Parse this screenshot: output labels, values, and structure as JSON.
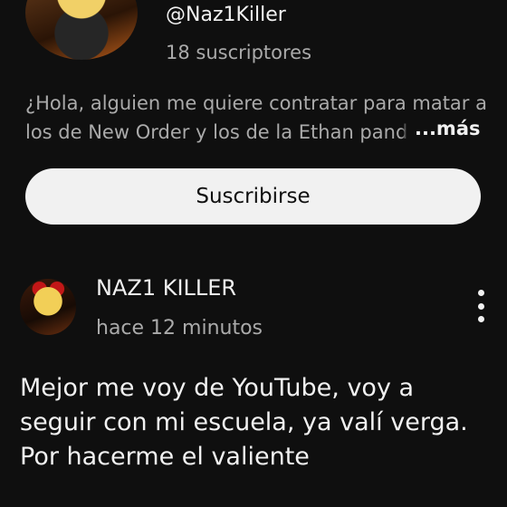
{
  "channel": {
    "handle": "@Naz1Killer",
    "subscribers": "18 suscriptores",
    "description_main": "¿Hola, alguien me quiere contratar para matar a los de New Order y los de la Ethan pan",
    "description_fade": "d",
    "more_label": "...más",
    "subscribe_label": "Suscribirse"
  },
  "post": {
    "author": "NAZ1 KILLER",
    "time": "hace 12 minutos",
    "body": "Mejor me voy de YouTube, voy a seguir con mi escuela, ya valí verga. Por hacerme el valiente"
  },
  "icons": {
    "more_options": "kebab-menu-icon"
  },
  "colors": {
    "background": "#0f0f0f",
    "primary_text": "#f1f1f1",
    "secondary_text": "#aaaaaa",
    "button_bg": "#f1f1f1"
  }
}
